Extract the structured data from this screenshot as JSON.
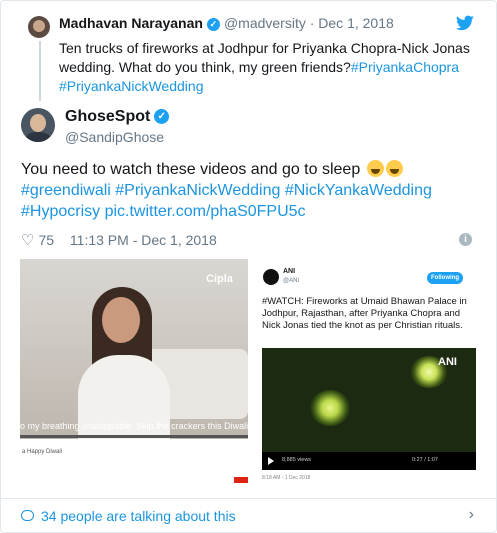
{
  "quoted": {
    "name": "Madhavan Narayanan",
    "verified_mark": "✓",
    "handle_date": "@madversity · Dec 1, 2018",
    "text": "Ten trucks of fireworks at Jodhpur for Priyanka Chopra-Nick Jonas wedding. What do you think, my green friends?",
    "hashtags": "#PriyankaChopra #PriyankaNickWedding"
  },
  "tweet": {
    "name": "GhoseSpot",
    "verified_mark": "✓",
    "handle": "@SandipGhose",
    "text": "You need to watch these videos and go to sleep",
    "hashtags_line1": "#greendiwali #PriyankaNickWedding #NickYankaWedding",
    "hashtags_line2": "#Hypocrisy pic.twitter.com/phaS0FPU5c",
    "likes": "75",
    "timestamp": "11:13 PM - Dec 1, 2018",
    "info_icon": "i"
  },
  "media_left": {
    "brand": "Cipla",
    "caption": "o my breathing unstoppable. Skip the crackers this Diwali",
    "video_title": "a Happy Diwali"
  },
  "media_right": {
    "account": "ANI",
    "handle": "@ANI",
    "follow_label": "Following",
    "tweet_text": "#WATCH: Fireworks at Umaid Bhawan Palace in Jodhpur, Rajasthan, after Priyanka Chopra and Nick Jonas tied the knot as per Christian rituals.",
    "logo": "ANI",
    "views": "8,885 views",
    "time": "0:27 / 1:07",
    "date": "8:18 AM - 1 Dec 2018"
  },
  "footer": {
    "talking": "34 people are talking about this",
    "chevron": "›"
  },
  "colors": {
    "link": "#1b95e0",
    "verified": "#1da1f2",
    "muted": "#657786"
  }
}
